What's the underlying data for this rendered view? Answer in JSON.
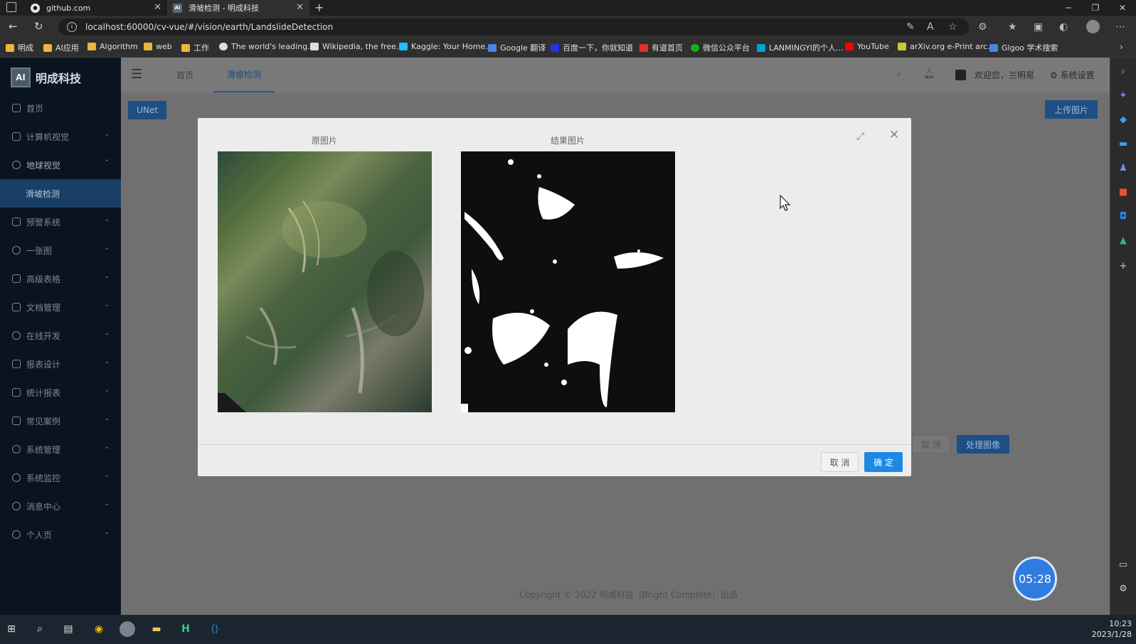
{
  "browser": {
    "tabs": [
      {
        "title": "github.com",
        "active": false
      },
      {
        "title": "滑坡检测 - 明成科技",
        "active": true
      }
    ],
    "new_tab": "+",
    "url": "localhost:60000/cv-vue/#/vision/earth/LandslideDetection",
    "bookmarks": [
      {
        "label": "明成",
        "icon": "folder-icon"
      },
      {
        "label": "AI应用",
        "icon": "folder-icon"
      },
      {
        "label": "Algorithm",
        "icon": "folder-icon"
      },
      {
        "label": "web",
        "icon": "folder-icon"
      },
      {
        "label": "工作",
        "icon": "folder-icon"
      },
      {
        "label": "The world's leading...",
        "icon": "github-icon"
      },
      {
        "label": "Wikipedia, the free...",
        "icon": "wikipedia-icon"
      },
      {
        "label": "Kaggle: Your Home...",
        "icon": "kaggle-icon"
      },
      {
        "label": "Google 翻译",
        "icon": "translate-icon"
      },
      {
        "label": "百度一下，你就知道",
        "icon": "baidu-icon"
      },
      {
        "label": "有道首页",
        "icon": "youdao-icon"
      },
      {
        "label": "微信公众平台",
        "icon": "wechat-icon"
      },
      {
        "label": "LANMINGYI的个人...",
        "icon": "bilibili-icon"
      },
      {
        "label": "YouTube",
        "icon": "youtube-icon"
      },
      {
        "label": "arXiv.org e-Print arc...",
        "icon": "arxiv-icon"
      },
      {
        "label": "Glgoo 学术搜索",
        "icon": "glgoo-icon"
      }
    ]
  },
  "app": {
    "logo_badge": "AI",
    "brand": "明成科技",
    "nav": [
      {
        "label": "首页",
        "icon": "home-icon",
        "chevron": ""
      },
      {
        "label": "计算机视觉",
        "icon": "camera-icon",
        "chevron": "⌄"
      },
      {
        "label": "地球视觉",
        "icon": "globe-icon",
        "chevron": "⌃"
      },
      {
        "label": "滑坡检测",
        "icon": "",
        "chevron": ""
      },
      {
        "label": "预警系统",
        "icon": "bell-icon",
        "chevron": "⌄"
      },
      {
        "label": "一张图",
        "icon": "map-pin-icon",
        "chevron": "⌄"
      },
      {
        "label": "高级表格",
        "icon": "table-icon",
        "chevron": "⌄"
      },
      {
        "label": "文档管理",
        "icon": "document-icon",
        "chevron": "⌄"
      },
      {
        "label": "在线开发",
        "icon": "cloud-icon",
        "chevron": "⌄"
      },
      {
        "label": "报表设计",
        "icon": "chart-icon",
        "chevron": "⌄"
      },
      {
        "label": "统计报表",
        "icon": "bar-chart-icon",
        "chevron": "⌄"
      },
      {
        "label": "常见案例",
        "icon": "grid-icon",
        "chevron": "⌄"
      },
      {
        "label": "系统管理",
        "icon": "gear-icon",
        "chevron": "⌄"
      },
      {
        "label": "系统监控",
        "icon": "monitor-icon",
        "chevron": "⌄"
      },
      {
        "label": "消息中心",
        "icon": "message-icon",
        "chevron": "⌄"
      },
      {
        "label": "个人页",
        "icon": "user-icon",
        "chevron": "⌄"
      }
    ],
    "topnav": {
      "home_tab": "首页",
      "active_tab": "滑坡检测",
      "welcome": "欢迎您，兰明易",
      "settings": "系统设置"
    },
    "model_button": "UNet",
    "upload_button": "上传图片",
    "bg_cancel": "取 消",
    "process_button": "处理图像",
    "copyright": "Copyright © 2022 明成科技（Bright Complete）出品"
  },
  "modal": {
    "original_title": "原图片",
    "result_title": "结果图片",
    "cancel": "取 消",
    "ok": "确 定",
    "fullscreen_icon": "⤢",
    "close_icon": "✕"
  },
  "timer": "05:28",
  "taskbar": {
    "time": "10:23",
    "date": "2023/1/28"
  },
  "colors": {
    "accent": "#1e88e5",
    "sidebar_bg": "#0a1420",
    "sidebar_active": "#1a3f66"
  }
}
